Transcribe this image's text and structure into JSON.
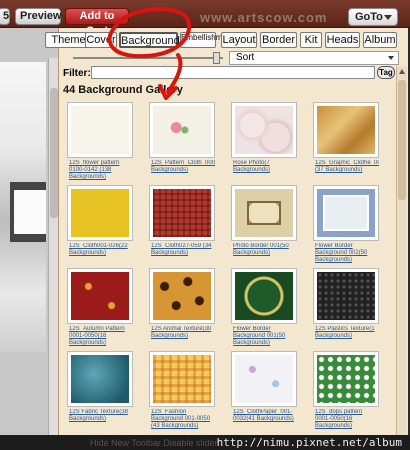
{
  "toolbar": {
    "left_fragment": "5",
    "preview": "Preview",
    "add_to_cart": "Add to Cart",
    "watermark": "www.artscow.com",
    "goto": "GoTo"
  },
  "tabs": [
    {
      "label": "Theme"
    },
    {
      "label": "Cover"
    },
    {
      "label": "Background"
    },
    {
      "label": "Embellishment"
    },
    {
      "label": "Layout"
    },
    {
      "label": "Border"
    },
    {
      "label": "Kit"
    },
    {
      "label": "Heads"
    },
    {
      "label": "Album"
    }
  ],
  "sort": {
    "value": "Sort"
  },
  "filter": {
    "label": "Filter:",
    "value": "",
    "tag": "Tag"
  },
  "gallery": {
    "title": "44 Background Gallery",
    "items": [
      {
        "caption": "12S_flower pattern 0100-0142 (138 Backgrounds)",
        "style": "flowers"
      },
      {
        "caption": "12S_Pattern_Cloth_0001_0050(16 Backgrounds)",
        "style": "roses"
      },
      {
        "caption": "Rose Photo(7 Backgrounds)",
        "style": "rosephoto"
      },
      {
        "caption": "12S_Graphic_Clothe_0001_0050 (37 Backgrounds)",
        "style": "gold"
      },
      {
        "caption": "12S_Cloth001-026(22 Backgrounds)",
        "style": "yellow"
      },
      {
        "caption": "12S_Cloth027-059 (34 Backgrounds)",
        "style": "plaid"
      },
      {
        "caption": "Photo Border 001(50 Backgrounds)",
        "style": "photoborder"
      },
      {
        "caption": "Flower Border Background 002(50 Backgrounds)",
        "style": "blueborder"
      },
      {
        "caption": "12S_Autumn Pattern 0001-0050(16 Backgrounds)",
        "style": "redautumn"
      },
      {
        "caption": "12S Animal Texture(30 Backgrounds)",
        "style": "leopard"
      },
      {
        "caption": "Flower Border Background 001(50 Backgrounds)",
        "style": "greenframe"
      },
      {
        "caption": "12S Plastics Texture(1 Backgrounds)",
        "style": "darkdots"
      },
      {
        "caption": "12S Fabric Texture(38 Backgrounds)",
        "style": "teal"
      },
      {
        "caption": "12S_Fashion Background 001-0050 (43 Backgrounds)",
        "style": "checks"
      },
      {
        "caption": "12S_ClothPaper_001-0032(41 Backgrounds)",
        "style": "paper"
      },
      {
        "caption": "12S_dops pattern 0001-0050(16 Backgrounds)",
        "style": "greendots"
      }
    ]
  },
  "status": {
    "options": "Hide New Toolbar   Disable slider",
    "url": "http://nimu.pixnet.net/album"
  }
}
